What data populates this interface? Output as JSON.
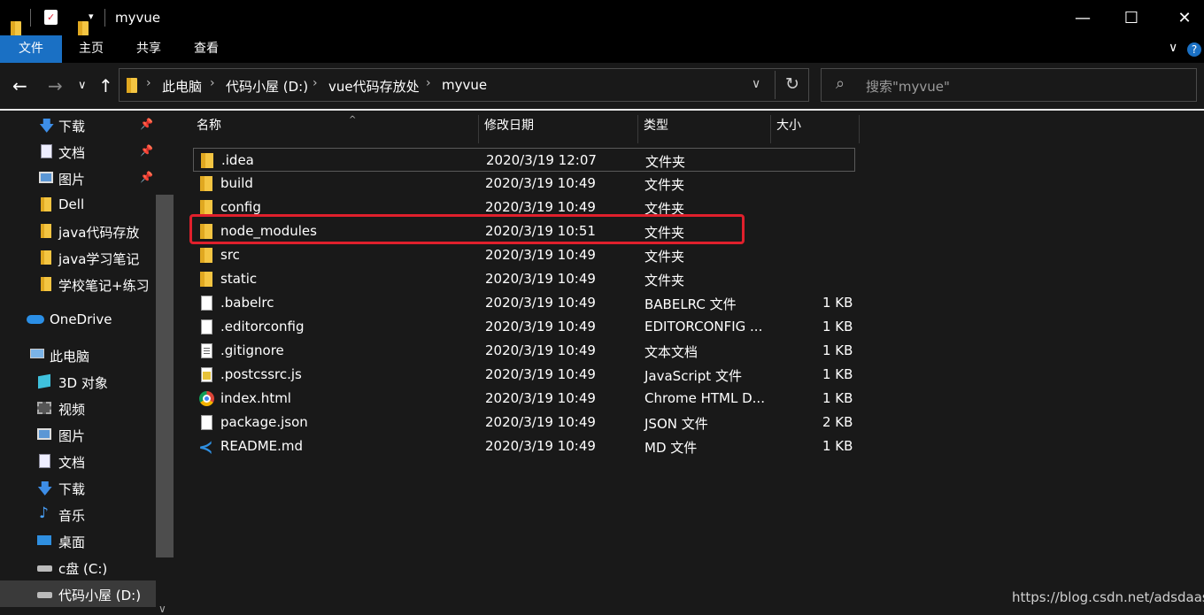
{
  "window": {
    "title": "myvue",
    "min_glyph": "—",
    "max_glyph": "☐",
    "close_glyph": "✕"
  },
  "ribbon": {
    "tabs": [
      {
        "label": "文件",
        "active": true
      },
      {
        "label": "主页",
        "active": false
      },
      {
        "label": "共享",
        "active": false
      },
      {
        "label": "查看",
        "active": false
      }
    ],
    "collapse_glyph": "∨",
    "help_glyph": "?"
  },
  "nav": {
    "back_glyph": "←",
    "forward_glyph": "→",
    "recent_glyph": "∨",
    "up_glyph": "↑",
    "breadcrumbs": [
      "此电脑",
      "代码小屋 (D:)",
      "vue代码存放处",
      "myvue"
    ],
    "crumb_separator": "›",
    "dropdown_glyph": "∨",
    "refresh_glyph": "↻",
    "search_placeholder": "搜索\"myvue\"",
    "search_glyph": "⌕"
  },
  "sidebar": {
    "items": [
      {
        "label": "下载",
        "icon": "download-arrow-icon",
        "pinned": true
      },
      {
        "label": "文档",
        "icon": "document-icon",
        "pinned": true
      },
      {
        "label": "图片",
        "icon": "picture-icon",
        "pinned": true
      },
      {
        "label": "Dell",
        "icon": "folder-icon",
        "pinned": false
      },
      {
        "label": "java代码存放",
        "icon": "folder-icon",
        "pinned": false
      },
      {
        "label": "java学习笔记",
        "icon": "folder-icon",
        "pinned": false
      },
      {
        "label": "学校笔记+练习",
        "icon": "folder-icon",
        "pinned": false
      },
      {
        "label": "OneDrive",
        "icon": "cloud-icon",
        "pinned": false
      },
      {
        "label": "此电脑",
        "icon": "computer-icon",
        "pinned": false
      },
      {
        "label": "3D 对象",
        "icon": "cube-3d-icon",
        "pinned": false
      },
      {
        "label": "视频",
        "icon": "video-icon",
        "pinned": false
      },
      {
        "label": "图片",
        "icon": "picture-icon",
        "pinned": false
      },
      {
        "label": "文档",
        "icon": "document-icon",
        "pinned": false
      },
      {
        "label": "下载",
        "icon": "download-arrow-icon",
        "pinned": false
      },
      {
        "label": "音乐",
        "icon": "music-note-icon",
        "pinned": false
      },
      {
        "label": "桌面",
        "icon": "desktop-icon",
        "pinned": false
      },
      {
        "label": "c盘 (C:)",
        "icon": "drive-icon",
        "pinned": false
      },
      {
        "label": "代码小屋 (D:)",
        "icon": "drive-icon",
        "pinned": false,
        "selected": true
      }
    ],
    "pin_glyph": "📌",
    "scroll_down_glyph": "∨"
  },
  "list": {
    "columns": {
      "name": "名称",
      "modified": "修改日期",
      "type": "类型",
      "size": "大小"
    },
    "sort_glyph": "^",
    "rows": [
      {
        "name": ".idea",
        "modified": "2020/3/19 12:07",
        "type": "文件夹",
        "size": "",
        "icon": "folder-icon"
      },
      {
        "name": "build",
        "modified": "2020/3/19 10:49",
        "type": "文件夹",
        "size": "",
        "icon": "folder-icon"
      },
      {
        "name": "config",
        "modified": "2020/3/19 10:49",
        "type": "文件夹",
        "size": "",
        "icon": "folder-icon"
      },
      {
        "name": "node_modules",
        "modified": "2020/3/19 10:51",
        "type": "文件夹",
        "size": "",
        "icon": "folder-icon"
      },
      {
        "name": "src",
        "modified": "2020/3/19 10:49",
        "type": "文件夹",
        "size": "",
        "icon": "folder-icon"
      },
      {
        "name": "static",
        "modified": "2020/3/19 10:49",
        "type": "文件夹",
        "size": "",
        "icon": "folder-icon"
      },
      {
        "name": ".babelrc",
        "modified": "2020/3/19 10:49",
        "type": "BABELRC 文件",
        "size": "1 KB",
        "icon": "blank-file-icon"
      },
      {
        "name": ".editorconfig",
        "modified": "2020/3/19 10:49",
        "type": "EDITORCONFIG ...",
        "size": "1 KB",
        "icon": "blank-file-icon"
      },
      {
        "name": ".gitignore",
        "modified": "2020/3/19 10:49",
        "type": "文本文档",
        "size": "1 KB",
        "icon": "text-file-icon"
      },
      {
        "name": ".postcssrc.js",
        "modified": "2020/3/19 10:49",
        "type": "JavaScript 文件",
        "size": "1 KB",
        "icon": "js-file-icon"
      },
      {
        "name": "index.html",
        "modified": "2020/3/19 10:49",
        "type": "Chrome HTML D...",
        "size": "1 KB",
        "icon": "chrome-icon"
      },
      {
        "name": "package.json",
        "modified": "2020/3/19 10:49",
        "type": "JSON 文件",
        "size": "2 KB",
        "icon": "blank-file-icon"
      },
      {
        "name": "README.md",
        "modified": "2020/3/19 10:49",
        "type": "MD 文件",
        "size": "1 KB",
        "icon": "vscode-icon"
      }
    ]
  },
  "watermark": "https://blog.csdn.net/adsdaas",
  "colors": {
    "accent": "#1a70c4",
    "folder": "#f4c542",
    "highlight": "#e0202c"
  }
}
